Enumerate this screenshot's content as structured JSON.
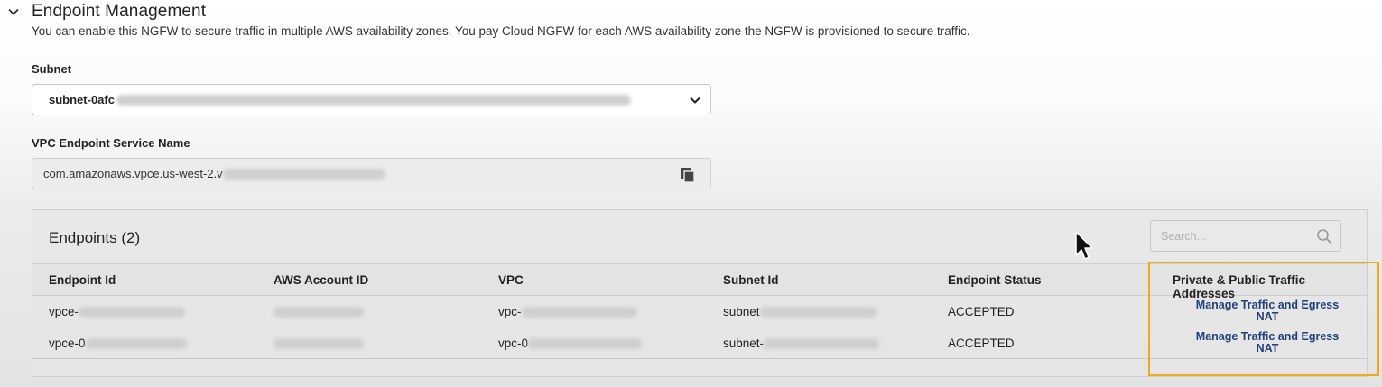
{
  "section": {
    "title": "Endpoint Management",
    "description": "You can enable this NGFW to secure traffic in multiple AWS availability zones. You pay Cloud NGFW for each AWS availability zone the NGFW is provisioned to secure traffic."
  },
  "subnet": {
    "label": "Subnet",
    "value_prefix": "subnet-0afc"
  },
  "vpc_endpoint_service": {
    "label": "VPC Endpoint Service Name",
    "value_prefix": "com.amazonaws.vpce.us-west-2.v"
  },
  "endpoints": {
    "title": "Endpoints (2)",
    "search_placeholder": "Search...",
    "columns": [
      "Endpoint Id",
      "AWS Account ID",
      "VPC",
      "Subnet Id",
      "Endpoint Status",
      "Private & Public Traffic Addresses"
    ],
    "rows": [
      {
        "endpoint_id": "vpce-",
        "vpc": "vpc-",
        "subnet_id": "subnet",
        "status": "ACCEPTED",
        "link_line1": "Manage Traffic and Egress",
        "link_line2": "NAT"
      },
      {
        "endpoint_id": "vpce-0",
        "vpc": "vpc-0",
        "subnet_id": "subnet-",
        "status": "ACCEPTED",
        "link_line1": "Manage Traffic and Egress",
        "link_line2": "NAT"
      }
    ]
  },
  "colors": {
    "link": "#1f3f7a",
    "highlight": "#f2a81d"
  }
}
